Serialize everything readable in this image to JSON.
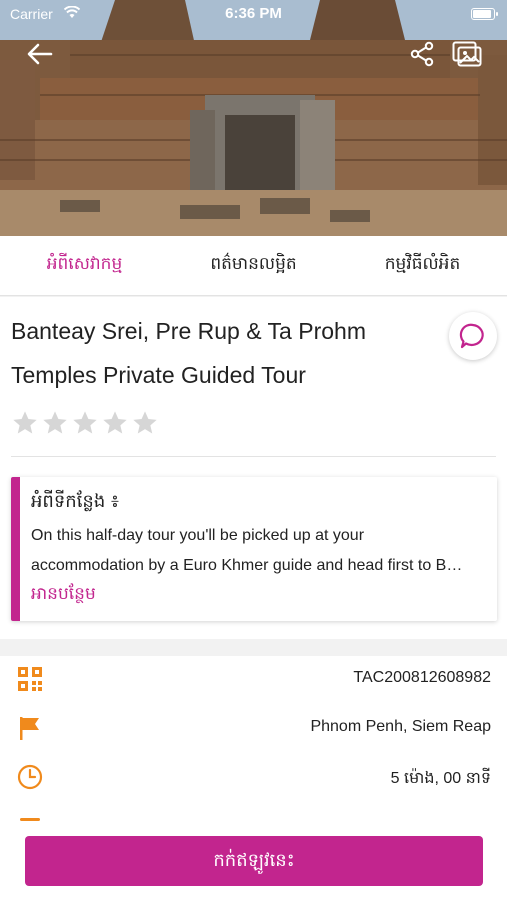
{
  "status_bar": {
    "carrier": "Carrier",
    "time": "6:36 PM"
  },
  "tabs": [
    {
      "label": "អំពីសេវាកម្ម",
      "active": true
    },
    {
      "label": "ពត៌មានលម្អិត",
      "active": false
    },
    {
      "label": "កម្មវិធីលំអិត",
      "active": false
    }
  ],
  "tour": {
    "title": "Banteay Srei, Pre Rup & Ta Prohm Temples Private Guided Tour",
    "rating": 0,
    "rating_max": 5
  },
  "about": {
    "heading": "អំពីទីកន្លែង ៖",
    "line1": "On this half-day tour you'll be picked up at your",
    "line2": "accommodation by a Euro Khmer guide and head first to B…",
    "read_more": "អានបន្ថែម"
  },
  "info": {
    "code": "TAC200812608982",
    "location": "Phnom Penh, Siem Reap",
    "duration": "5 ម៉ោង, 00 នាទី"
  },
  "book_button": "កក់ឥឡូវនេះ",
  "colors": {
    "accent": "#c2258e",
    "icon": "#f08a1c"
  }
}
